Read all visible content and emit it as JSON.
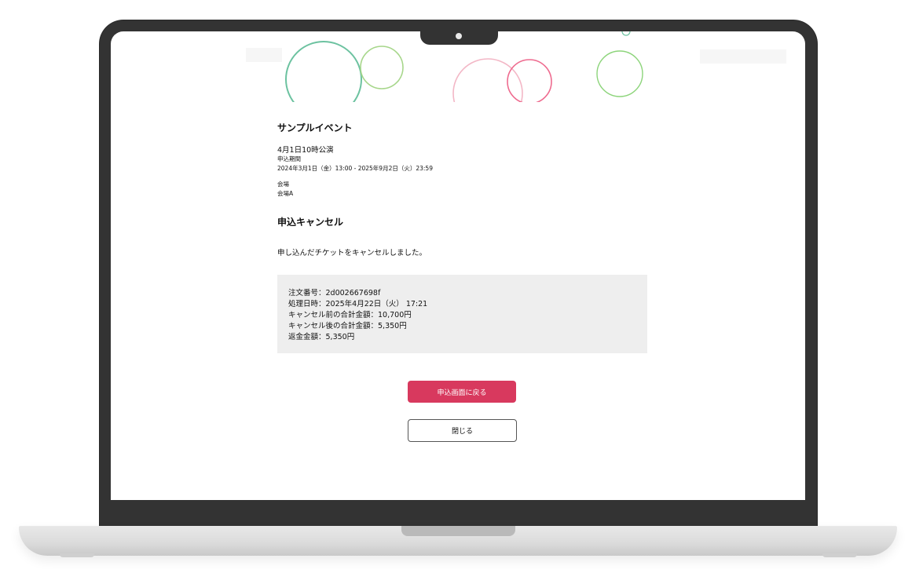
{
  "event": {
    "title": "サンプルイベント",
    "performance": "4月1日10時公演",
    "application_period_label": "申込期間",
    "application_period": "2024年3月1日（金）13:00 - 2025年9月2日（火）23:59",
    "venue_label": "会場",
    "venue": "会場A"
  },
  "cancel": {
    "section_title": "申込キャンセル",
    "message": "申し込んだチケットをキャンセルしました。",
    "details": {
      "order_number": "注文番号：2d002667698f",
      "processed_at": "処理日時：2025年4月22日（火） 17:21",
      "total_before": "キャンセル前の合計金額：10,700円",
      "total_after": "キャンセル後の合計金額：5,350円",
      "refund_amount": "返金金額：5,350円"
    }
  },
  "buttons": {
    "back_label": "申込画面に戻る",
    "close_label": "閉じる"
  },
  "colors": {
    "primary": "#d8395e",
    "circle_green": "#6cc2a0",
    "circle_lime": "#a6d68a",
    "circle_pink": "#f3b7c6",
    "circle_rose": "#ee6b8f",
    "circle_bright_green": "#8cd47a"
  }
}
